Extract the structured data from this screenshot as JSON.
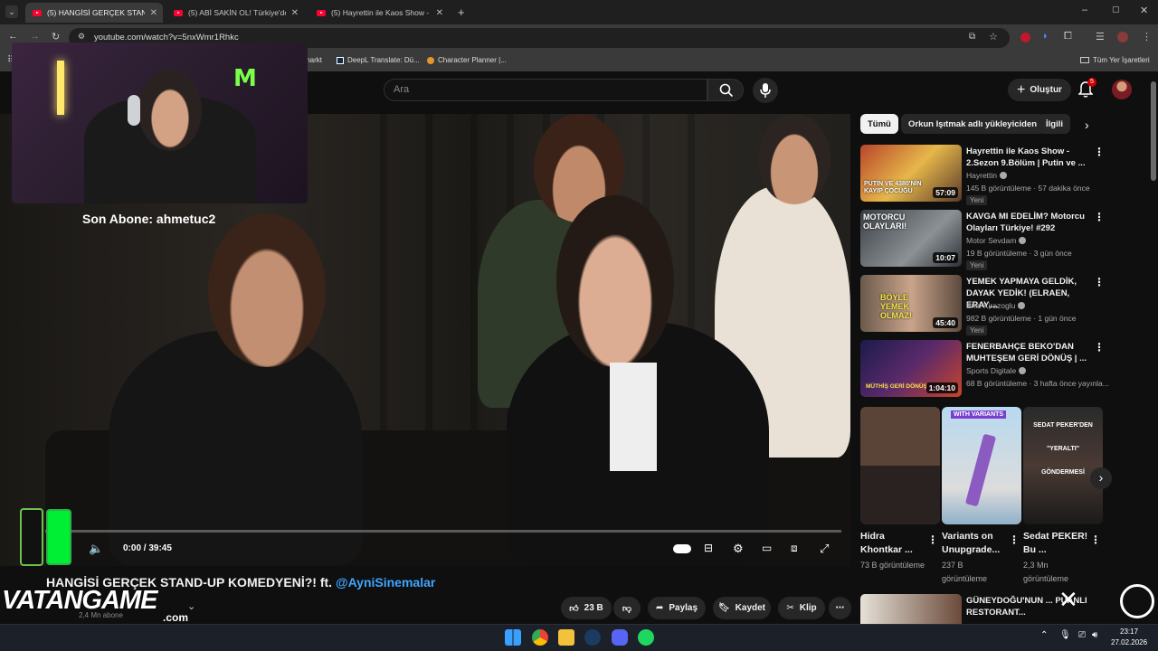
{
  "browser": {
    "tabs": [
      {
        "title": "(5) HANGİSİ GERÇEK STAND-UP",
        "active": true
      },
      {
        "title": "(5) ABİ SAKİN OL! Türkiye'deki",
        "active": false
      },
      {
        "title": "(5) Hayrettin ile Kaos Show - 2.",
        "active": false
      }
    ],
    "url": "youtube.com/watch?v=5nxWmr1Rhkc",
    "bookmarks": [
      "markt",
      "DeepL Translate: Dü...",
      "Character Planner |..."
    ],
    "all_bookmarks": "Tüm Yer İşaretleri"
  },
  "header": {
    "search_placeholder": "Ara",
    "create_label": "Oluştur",
    "notification_count": "5"
  },
  "overlay": {
    "last_sub": "Son Abone: ahmetuc2",
    "brand": "VATANGAME",
    "brand_sub": ".com"
  },
  "player": {
    "time": "0:00 / 39:45"
  },
  "video": {
    "title": "HANGİSİ GERÇEK STAND-UP KOMEDYENİ?! ft.",
    "mention": "@AyniSinemalar",
    "channel_subs": "2,4 Mn abone",
    "likes": "23 B",
    "share": "Paylaş",
    "save": "Kaydet",
    "clip": "Klip"
  },
  "sidebar": {
    "chips": [
      "Tümü",
      "Orkun Işıtmak adlı yükleyiciden",
      "İlgili"
    ],
    "recommendations": [
      {
        "title": "Hayrettin ile Kaos Show - 2.Sezon 9.Bölüm | Putin ve ...",
        "channel": "Hayrettin",
        "stats": "145 B görüntüleme · 57 dakika önce",
        "badge": "Yeni",
        "duration": "57:09",
        "thumb_text": "PUTİN VE 4380'NİN KAYIP ÇOCUĞU"
      },
      {
        "title": "KAVGA MI EDELİM? Motorcu Olayları Türkiye! #292",
        "channel": "Motor Sevdam",
        "stats": "19 B görüntüleme · 3 gün önce",
        "badge": "Yeni",
        "duration": "10:07",
        "thumb_text": "MOTORCU OLAYLARI!"
      },
      {
        "title": "YEMEK YAPMAYA GELDİK, DAYAK YEDİK! (ELRAEN, ERAY,...",
        "channel": "Enis Kirazoglu",
        "stats": "982 B görüntüleme · 1 gün önce",
        "badge": "Yeni",
        "duration": "45:40",
        "thumb_text": "BÖYLE YEMEK OLMAZ!"
      },
      {
        "title": "FENERBAHÇE BEKO'DAN MUHTEŞEM GERİ DÖNÜŞ | ...",
        "channel": "Sports Digitale",
        "stats": "68 B görüntüleme · 3 hafta önce yayınla...",
        "badge": "",
        "duration": "1:04:10",
        "thumb_text": "MÜTHİŞ GERİ DÖNÜŞ"
      }
    ],
    "shorts": [
      {
        "title": "Hidra Khontkar ...",
        "views": "73 B görüntüleme"
      },
      {
        "title": "Variants on Unupgrade...",
        "views": "237 B görüntüleme",
        "thumb_text": "WITH VARIANTS"
      },
      {
        "title": "Sedat PEKER! Bu ...",
        "views": "2,3 Mn görüntüleme",
        "thumb_text": "SEDAT PEKER'DEN \"YERALTI\" GÖNDERMESİ"
      }
    ],
    "last_rec_title": "GÜNEYDOĞU'NUN ... PUANLI RESTORANT..."
  },
  "taskbar": {
    "time": "23:17",
    "date": "27.02.2026"
  }
}
